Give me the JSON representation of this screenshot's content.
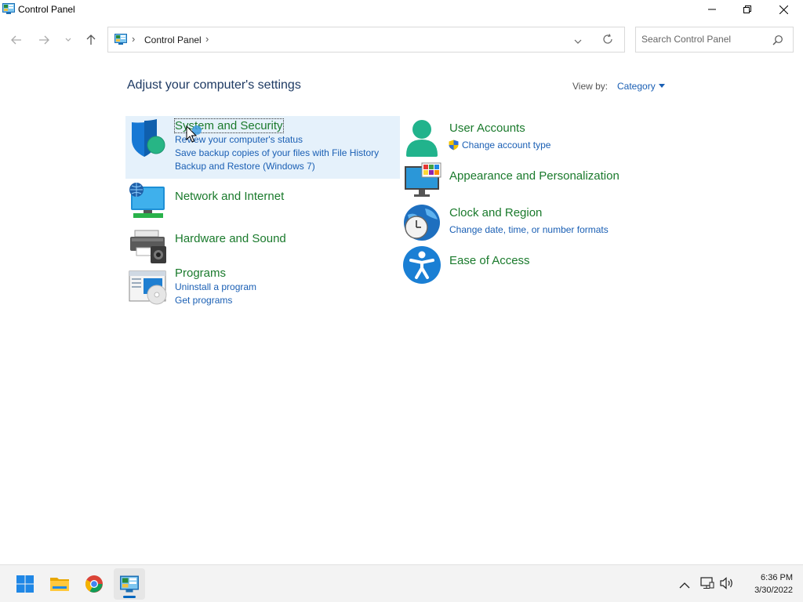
{
  "window": {
    "title": "Control Panel",
    "controls": [
      "minimize",
      "restore",
      "close"
    ]
  },
  "address_bar": {
    "breadcrumb": "Control Panel",
    "icons": [
      "control-panel-icon",
      "chevron-right-icon",
      "chevron-down-icon",
      "refresh-icon"
    ]
  },
  "search": {
    "placeholder": "Search Control Panel"
  },
  "main": {
    "title": "Adjust your computer's settings",
    "view_by_label": "View by:",
    "view_by_value": "Category"
  },
  "categories": [
    {
      "title": "System and Security",
      "icon": "shield-icon",
      "links": [
        "Review your computer's status",
        "Save backup copies of your files with File History",
        "Backup and Restore (Windows 7)"
      ]
    },
    {
      "title": "Network and Internet",
      "icon": "network-icon",
      "links": []
    },
    {
      "title": "Hardware and Sound",
      "icon": "printer-icon",
      "links": []
    },
    {
      "title": "Programs",
      "icon": "programs-icon",
      "links": [
        "Uninstall a program",
        "Get programs"
      ]
    },
    {
      "title": "User Accounts",
      "icon": "user-icon",
      "links": [
        "Change account type"
      ]
    },
    {
      "title": "Appearance and Personalization",
      "icon": "monitor-palette-icon",
      "links": []
    },
    {
      "title": "Clock and Region",
      "icon": "clock-globe-icon",
      "links": [
        "Change date, time, or number formats"
      ]
    },
    {
      "title": "Ease of Access",
      "icon": "accessibility-icon",
      "links": []
    }
  ],
  "taskbar": {
    "apps": [
      "start-icon",
      "file-explorer-icon",
      "chrome-icon",
      "control-panel-icon"
    ],
    "time": "6:36 PM",
    "date": "3/30/2022"
  },
  "colors": {
    "category_title": "#1a7a2c",
    "link": "#1a5fb4",
    "page_title": "#1e3a63",
    "selection": "#e5f1fb",
    "accent": "#0067c0"
  }
}
